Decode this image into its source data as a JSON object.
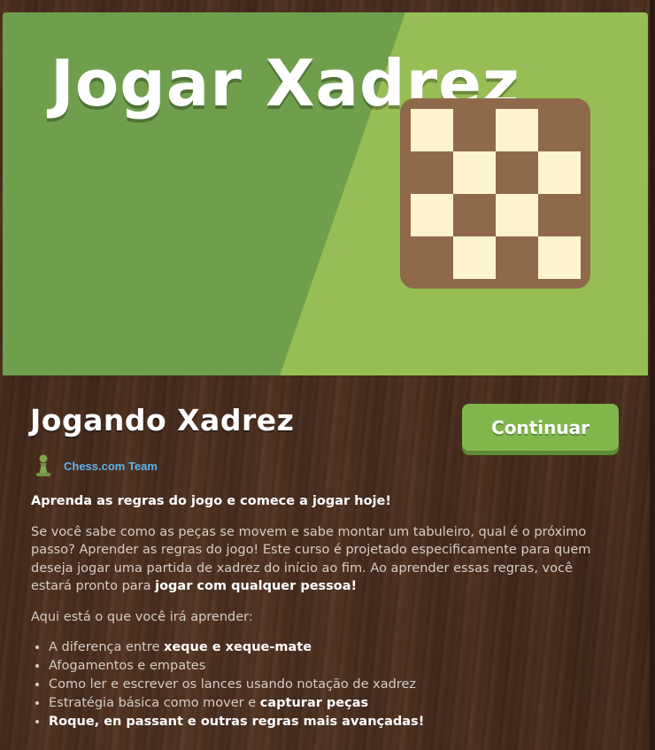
{
  "hero": {
    "title": "Jogar Xadrez"
  },
  "course": {
    "title": "Jogando Xadrez",
    "continue_label": "Continuar",
    "author": "Chess.com Team"
  },
  "description": {
    "lead": "Aprenda as regras do jogo e comece a jogar hoje!",
    "paragraph_text": "Se você sabe como as peças se movem e sabe montar um tabuleiro, qual é o próximo passo? Aprender as regras do jogo! Este curso é projetado especificamente para quem deseja jogar uma partida de xadrez do início ao fim. Ao aprender essas regras, você estará pronto para ",
    "paragraph_bold": "jogar com qualquer pessoa!",
    "list_intro": "Aqui está o que você irá aprender:",
    "items": [
      {
        "before": "A diferença entre ",
        "bold": "xeque e xeque-mate",
        "after": ""
      },
      {
        "before": "Afogamentos e empates",
        "bold": "",
        "after": ""
      },
      {
        "before": "Como ler e escrever os lances usando notação de xadrez",
        "bold": "",
        "after": ""
      },
      {
        "before": "Estratégia básica como mover e ",
        "bold": "capturar peças",
        "after": ""
      },
      {
        "before": "",
        "bold": "Roque, en passant e outras regras mais avançadas!",
        "after": ""
      }
    ]
  },
  "colors": {
    "hero_light_green": "#97be54",
    "hero_dark_green": "#6f9f4c",
    "button_green": "#81b64c",
    "link_blue": "#5fb4ea",
    "board_brown": "#8f6a4a",
    "board_cream": "#fdf4cf"
  },
  "icons": {
    "author_icon": "pawn-icon"
  }
}
